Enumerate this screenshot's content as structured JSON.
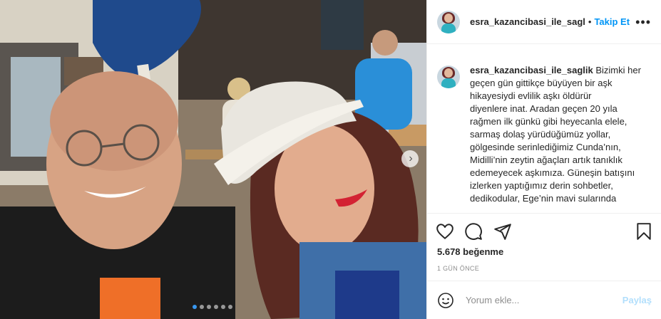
{
  "photo": {
    "alt": "",
    "carousel_dots": 6,
    "active_dot": 0
  },
  "header": {
    "username": "esra_kazancibasi_ile_sagl",
    "separator": "•",
    "follow_label": "Takip Et",
    "more_icon": "more-horizontal-icon"
  },
  "caption": {
    "username": "esra_kazancibasi_ile_saglik",
    "text": " Bizimki her\ngeçen gün gittikçe büyüyen bir aşk\nhikayesiydi evlilik aşkı öldürür\ndiyenlere inat. Aradan geçen 20 yıla\nrağmen ilk günkü gibi heyecanla elele,\nsarmaş dolaş yürüdüğümüz yollar,\ngölgesinde serinlediğimiz Cunda’nın,\nMidilli’nin zeytin ağaçları artık tanıklık\nedemeyecek aşkımıza. Güneşin batışını\nizlerken yaptığımız derin sohbetler,\ndedikodular, Ege’nin mavi sularında"
  },
  "actions": {
    "like_icon": "heart-icon",
    "comment_icon": "comment-icon",
    "share_icon": "share-icon",
    "save_icon": "bookmark-icon"
  },
  "likes_text": "5.678 beğenme",
  "date_text": "1 GÜN ÖNCE",
  "comment_box": {
    "emoji_icon": "emoji-icon",
    "placeholder": "Yorum ekle...",
    "share_label": "Paylaş"
  },
  "colors": {
    "accent": "#0095f6",
    "share_disabled": "#b2dffc",
    "active_dot": "#3897f0"
  }
}
